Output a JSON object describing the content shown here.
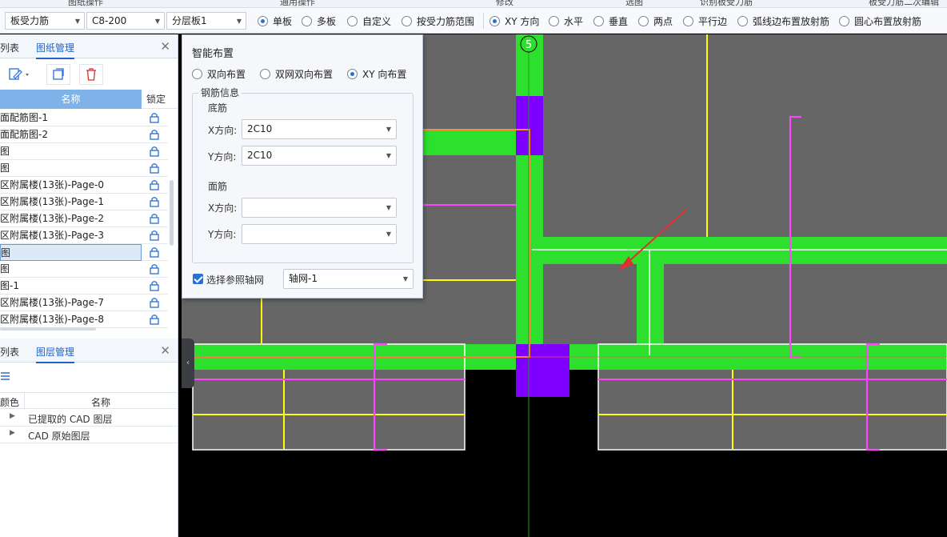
{
  "topstrip": {
    "items": [
      "图纸操作",
      "通用操作",
      "修改",
      "选图",
      "识别板受力筋",
      "板受力筋二次编辑"
    ]
  },
  "optionbar": {
    "combo1": "板受力筋",
    "combo2": "C8-200",
    "combo3": "分层板1",
    "radios1": [
      {
        "label": "单板",
        "checked": true
      },
      {
        "label": "多板",
        "checked": false
      },
      {
        "label": "自定义",
        "checked": false
      },
      {
        "label": "按受力筋范围",
        "checked": false
      }
    ],
    "radios2": [
      {
        "label": "XY 方向",
        "checked": true
      },
      {
        "label": "水平",
        "checked": false
      },
      {
        "label": "垂直",
        "checked": false
      },
      {
        "label": "两点",
        "checked": false
      },
      {
        "label": "平行边",
        "checked": false
      },
      {
        "label": "弧线边布置放射筋",
        "checked": false
      },
      {
        "label": "圆心布置放射筋",
        "checked": false
      }
    ]
  },
  "drawing_panel": {
    "tabs": [
      "列表",
      "图纸管理"
    ],
    "col_name": "名称",
    "col_lock": "锁定",
    "rows": [
      "面配筋图-1",
      "面配筋图-2",
      "图",
      "图",
      "区附属楼(13张)-Page-0",
      "区附属楼(13张)-Page-1",
      "区附属楼(13张)-Page-2",
      "区附属楼(13张)-Page-3",
      "图",
      "图",
      "图-1",
      "区附属楼(13张)-Page-7",
      "区附属楼(13张)-Page-8"
    ],
    "selected_row_index": 8
  },
  "layer_panel": {
    "tabs": [
      "列表",
      "图层管理"
    ],
    "col_color": "颜色",
    "col_name": "名称",
    "rows": [
      "已提取的 CAD 图层",
      "CAD 原始图层"
    ]
  },
  "dialog": {
    "title": "智能布置",
    "modes": [
      {
        "label": "双向布置",
        "checked": false
      },
      {
        "label": "双网双向布置",
        "checked": false
      },
      {
        "label": "XY 向布置",
        "checked": true
      }
    ],
    "group_title": "钢筋信息",
    "bottom": {
      "title": "底筋",
      "x_label": "X方向:",
      "x_value": "2C10",
      "y_label": "Y方向:",
      "y_value": "2C10"
    },
    "top": {
      "title": "面筋",
      "x_label": "X方向:",
      "x_value": "",
      "y_label": "Y方向:",
      "y_value": ""
    },
    "ref_axis_label": "选择参照轴网",
    "ref_axis_checked": true,
    "ref_axis_value": "轴网-1"
  },
  "canvas": {
    "axis_label": "5",
    "colors": {
      "background": "#000000",
      "slab": "#666666",
      "beam": "#2ee02e",
      "column": "#8000ff",
      "yellow_rebar": "#ffff00",
      "magenta_rebar": "#ff44ff",
      "edge_white": "#ffffff",
      "arrow": "#e03030"
    }
  }
}
